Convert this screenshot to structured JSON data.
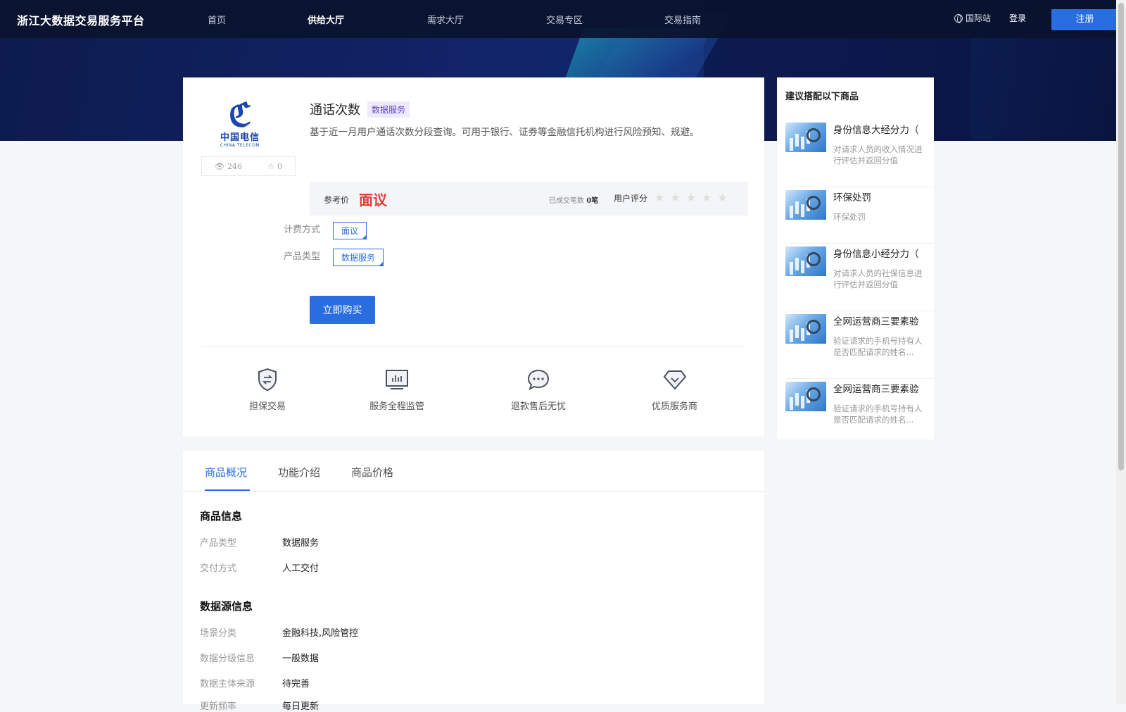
{
  "header": {
    "brand": "浙江大数据交易服务平台",
    "nav": [
      "首页",
      "供给大厅",
      "需求大厅",
      "交易专区",
      "交易指南"
    ],
    "active_nav": "供给大厅",
    "intl": "国际站",
    "login": "登录",
    "register": "注册"
  },
  "product": {
    "logo_cn": "中国电信",
    "logo_en": "CHINA TELECOM",
    "views": "246",
    "favorites": "0",
    "title": "通话次数",
    "tag": "数据服务",
    "description": "基于近一月用户通话次数分段查询。可用于银行、证券等金融信托机构进行风险预知、规避。",
    "price_label": "参考价",
    "price": "面议",
    "deals_label": "已成交笔数",
    "deals_value": "0笔",
    "rating_label": "用户评分",
    "rating": 0,
    "billing_label": "计费方式",
    "billing_value": "面议",
    "type_label": "产品类型",
    "type_value": "数据服务",
    "buy": "立即购买"
  },
  "features": [
    {
      "label": "担保交易",
      "icon": "shield-exchange-icon"
    },
    {
      "label": "服务全程监管",
      "icon": "monitor-chart-icon"
    },
    {
      "label": "退款售后无忧",
      "icon": "chat-bubble-icon"
    },
    {
      "label": "优质服务商",
      "icon": "diamond-icon"
    }
  ],
  "sidebar": {
    "title": "建议搭配以下商品",
    "items": [
      {
        "name": "身份信息大经分力（",
        "desc": "对请求人员的收入情况进行评估并返回分值"
      },
      {
        "name": "环保处罚",
        "desc": "环保处罚"
      },
      {
        "name": "身份信息小经分力（",
        "desc": "对请求人员的社保信息进行评估并返回分值"
      },
      {
        "name": "全网运营商三要素验",
        "desc": "验证请求的手机号持有人是否匹配请求的姓名..."
      },
      {
        "name": "全网运营商三要素验",
        "desc": "验证请求的手机号持有人是否匹配请求的姓名..."
      }
    ]
  },
  "tabs": [
    "商品概况",
    "功能介绍",
    "商品价格"
  ],
  "active_tab": "商品概况",
  "overview": {
    "section1": "商品信息",
    "info1": [
      {
        "k": "产品类型",
        "v": "数据服务"
      },
      {
        "k": "交付方式",
        "v": "人工交付"
      }
    ],
    "section2": "数据源信息",
    "info2": [
      {
        "k": "场景分类",
        "v": "金融科技,风险管控"
      },
      {
        "k": "数据分级信息",
        "v": "一般数据"
      },
      {
        "k": "数据主体来源",
        "v": "待完善"
      },
      {
        "k": "更新频率",
        "v": "每日更新"
      }
    ]
  },
  "colors": {
    "accent": "#2a6de0",
    "price": "#e23a3a",
    "tag_text": "#5b3fd0"
  }
}
